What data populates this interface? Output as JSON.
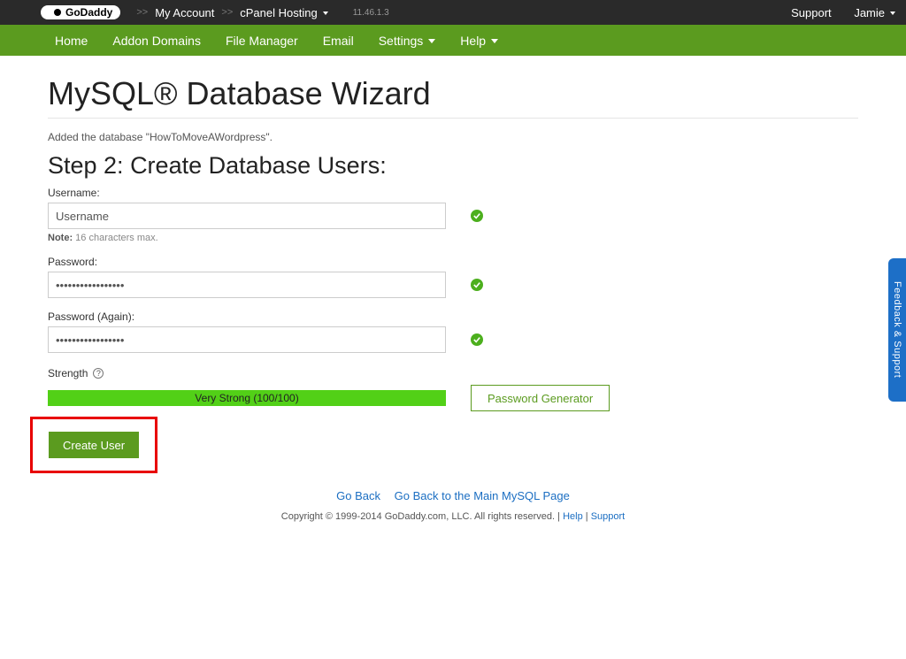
{
  "topbar": {
    "logo_text": "GoDaddy",
    "crumbs": [
      "My Account",
      "cPanel Hosting"
    ],
    "version": "11.46.1.3",
    "support": "Support",
    "user": "Jamie"
  },
  "nav": {
    "items": [
      {
        "label": "Home",
        "dropdown": false
      },
      {
        "label": "Addon Domains",
        "dropdown": false
      },
      {
        "label": "File Manager",
        "dropdown": false
      },
      {
        "label": "Email",
        "dropdown": false
      },
      {
        "label": "Settings",
        "dropdown": true
      },
      {
        "label": "Help",
        "dropdown": true
      }
    ]
  },
  "page": {
    "title": "MySQL® Database Wizard",
    "added_msg": "Added the database \"HowToMoveAWordpress\".",
    "step_heading": "Step 2: Create Database Users:"
  },
  "form": {
    "username_label": "Username:",
    "username_value": "Username",
    "username_note_prefix": "Note:",
    "username_note_text": " 16 characters max.",
    "password_label": "Password:",
    "password_value": "•••••••••••••••••",
    "password2_label": "Password (Again):",
    "password2_value": "•••••••••••••••••",
    "strength_label": "Strength",
    "strength_text": "Very Strong (100/100)",
    "pwgen_label": "Password Generator",
    "create_label": "Create User"
  },
  "footer": {
    "go_back": "Go Back",
    "main_mysql": "Go Back to the Main MySQL Page",
    "copyright": "Copyright © 1999-2014 GoDaddy.com, LLC. All rights reserved. | ",
    "help": "Help",
    "sep": " | ",
    "support": "Support"
  },
  "feedback": {
    "label": "Feedback & Support"
  }
}
